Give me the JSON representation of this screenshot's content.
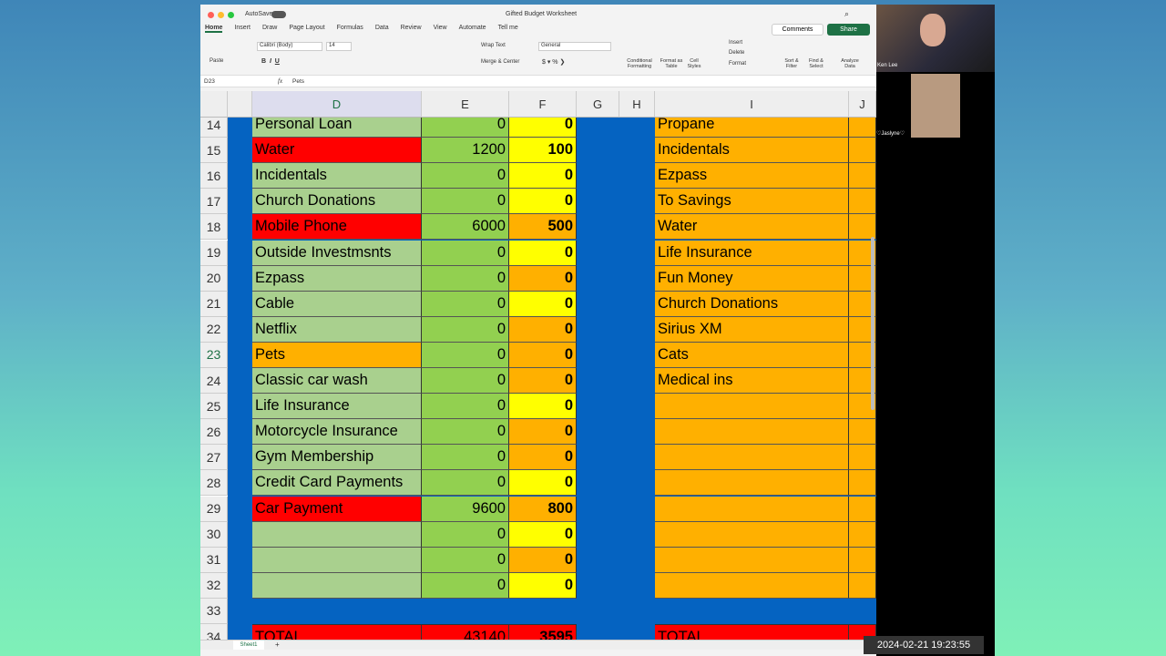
{
  "window": {
    "title": "Gifted Budget Worksheet",
    "autosave": "AutoSave"
  },
  "tabs": [
    "Home",
    "Insert",
    "Draw",
    "Page Layout",
    "Formulas",
    "Data",
    "Review",
    "View",
    "Automate",
    "Tell me"
  ],
  "ribbon": {
    "paste": "Paste",
    "font": "Calibri (Body)",
    "size": "14",
    "wrap": "Wrap Text",
    "merge": "Merge & Center",
    "format": "General",
    "cond": "Conditional Formatting",
    "table": "Format as Table",
    "styles": "Cell Styles",
    "insert": "Insert",
    "delete": "Delete",
    "formatc": "Format",
    "sort": "Sort & Filter",
    "find": "Find & Select",
    "analyze": "Analyze Data",
    "comments": "Comments",
    "share": "Share"
  },
  "formula_bar": {
    "cell": "D23",
    "fx": "fx",
    "value": "Pets"
  },
  "columns": [
    "D",
    "E",
    "F",
    "G",
    "H",
    "I",
    "J"
  ],
  "colors": {
    "green_label": "#a9d08e",
    "green_value": "#92d050",
    "red": "#ff0000",
    "yellow": "#ffff00",
    "orange": "#ffb000",
    "blue": "#0563c1"
  },
  "rows": [
    {
      "n": "14",
      "d": "Personal Loan",
      "dc": "g",
      "e": "0",
      "f": "0",
      "fc": "y",
      "i": "Propane"
    },
    {
      "n": "15",
      "d": "Water",
      "dc": "r",
      "e": "1200",
      "f": "100",
      "fc": "y",
      "i": "Incidentals"
    },
    {
      "n": "16",
      "d": "Incidentals",
      "dc": "g",
      "e": "0",
      "f": "0",
      "fc": "y",
      "i": "Ezpass"
    },
    {
      "n": "17",
      "d": "Church Donations",
      "dc": "g",
      "e": "0",
      "f": "0",
      "fc": "y",
      "i": "To Savings"
    },
    {
      "n": "18",
      "d": "Mobile Phone",
      "dc": "r",
      "e": "6000",
      "f": "500",
      "fc": "o",
      "i": "Water"
    },
    {
      "n": "19",
      "d": "Outside Investmsnts",
      "dc": "g",
      "e": "0",
      "f": "0",
      "fc": "y",
      "i": "Life Insurance"
    },
    {
      "n": "20",
      "d": "Ezpass",
      "dc": "g",
      "e": "0",
      "f": "0",
      "fc": "o",
      "i": "Fun Money"
    },
    {
      "n": "21",
      "d": "Cable",
      "dc": "g",
      "e": "0",
      "f": "0",
      "fc": "y",
      "i": "Church Donations"
    },
    {
      "n": "22",
      "d": "Netflix",
      "dc": "g",
      "e": "0",
      "f": "0",
      "fc": "o",
      "i": "Sirius XM"
    },
    {
      "n": "23",
      "d": "Pets",
      "dc": "o",
      "e": "0",
      "f": "0",
      "fc": "o",
      "i": "Cats"
    },
    {
      "n": "24",
      "d": "Classic car wash",
      "dc": "g",
      "e": "0",
      "f": "0",
      "fc": "o",
      "i": "Medical ins"
    },
    {
      "n": "25",
      "d": "Life Insurance",
      "dc": "g",
      "e": "0",
      "f": "0",
      "fc": "y",
      "i": ""
    },
    {
      "n": "26",
      "d": "Motorcycle Insurance",
      "dc": "g",
      "e": "0",
      "f": "0",
      "fc": "o",
      "i": ""
    },
    {
      "n": "27",
      "d": "Gym Membership",
      "dc": "g",
      "e": "0",
      "f": "0",
      "fc": "o",
      "i": ""
    },
    {
      "n": "28",
      "d": "Credit Card Payments",
      "dc": "g",
      "e": "0",
      "f": "0",
      "fc": "y",
      "i": ""
    },
    {
      "n": "29",
      "d": "Car Payment",
      "dc": "r",
      "e": "9600",
      "f": "800",
      "fc": "o",
      "i": ""
    },
    {
      "n": "30",
      "d": "",
      "dc": "g",
      "e": "0",
      "f": "0",
      "fc": "y",
      "i": ""
    },
    {
      "n": "31",
      "d": "",
      "dc": "g",
      "e": "0",
      "f": "0",
      "fc": "o",
      "i": ""
    },
    {
      "n": "32",
      "d": "",
      "dc": "g",
      "e": "0",
      "f": "0",
      "fc": "y",
      "i": ""
    }
  ],
  "row33": "33",
  "total": {
    "n": "34",
    "label": "TOTAL",
    "e": "43140",
    "f": "3595",
    "i": "TOTAL"
  },
  "sheet_tab": "Sheet1",
  "participants": [
    "Ken Lee",
    "♡Jaslyne♡"
  ],
  "timestamp": "2024-02-21 19:23:55"
}
